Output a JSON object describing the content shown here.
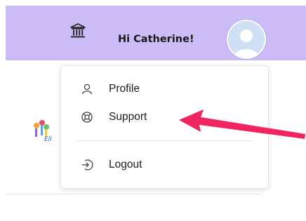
{
  "header": {
    "greeting": "Hi Catherine!",
    "icons": {
      "bank": "bank-icon",
      "avatar": "user-avatar-icon"
    },
    "background_color": "#cbbcf7"
  },
  "background": {
    "logo_text": "Ell"
  },
  "dropdown": {
    "items": [
      {
        "label": "Profile",
        "icon": "user-icon"
      },
      {
        "label": "Support",
        "icon": "support-icon"
      },
      {
        "label": "Logout",
        "icon": "logout-icon"
      }
    ]
  },
  "annotation": {
    "arrow_color": "#f0245f",
    "points_to": "Support"
  }
}
